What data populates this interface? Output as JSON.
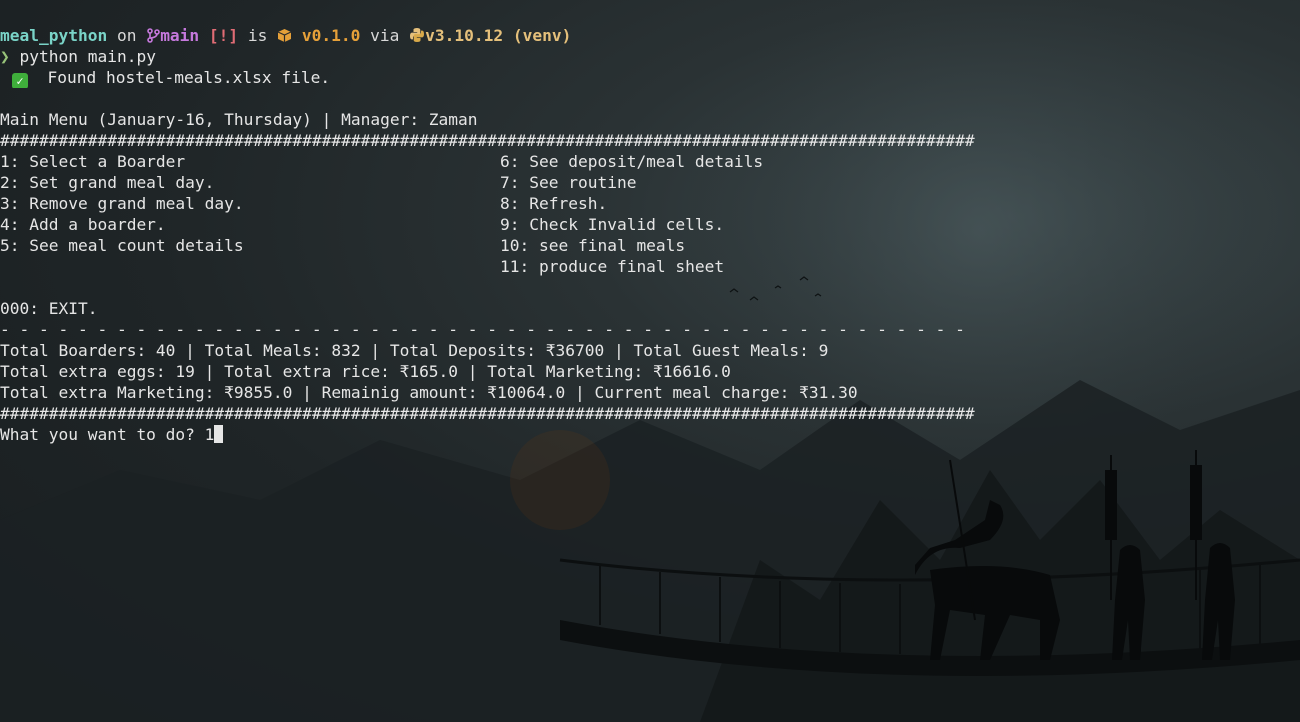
{
  "prompt": {
    "dir": "meal_python",
    "on": " on ",
    "branch_icon": "git-branch-icon",
    "branch": "main",
    "status": "[!]",
    "is": " is ",
    "package_icon": "package-icon",
    "version": "v0.1.0",
    "via": " via ",
    "python_icon": "python-icon",
    "python_version": "v3.10.12",
    "venv": "(venv)",
    "prompt_char": "❯",
    "command": "python main.py"
  },
  "found_line": {
    "icon": "check-mark-icon",
    "text": "Found hostel-meals.xlsx file."
  },
  "menu": {
    "header": "Main Menu (January-16, Thursday) | Manager: Zaman",
    "separator": "####################################################################################################",
    "left_items": [
      "1: Select a Boarder",
      "2: Set grand meal day.",
      "3: Remove grand meal day.",
      "4: Add a boarder.",
      "5: See meal count details",
      ""
    ],
    "right_items": [
      "6: See deposit/meal details",
      "7: See routine",
      "8: Refresh.",
      "9: Check Invalid cells.",
      "10: see final meals",
      "11: produce final sheet"
    ],
    "exit": "000: EXIT.",
    "dash_separator": "- - - - - - - - - - - - - - - - - - - - - - - - - - - - - - - - - - - - - - - - - - - - - - - - - -"
  },
  "stats": {
    "line1": "Total Boarders: 40 | Total Meals: 832 | Total Deposits: ₹36700 | Total Guest Meals: 9",
    "line2": "Total extra eggs: 19 | Total extra rice: ₹165.0 | Total Marketing: ₹16616.0",
    "line3": "Total extra Marketing: ₹9855.0 | Remainig amount: ₹10064.0 | Current meal charge: ₹31.30"
  },
  "input": {
    "question": "What you want to do? ",
    "value": "1"
  }
}
